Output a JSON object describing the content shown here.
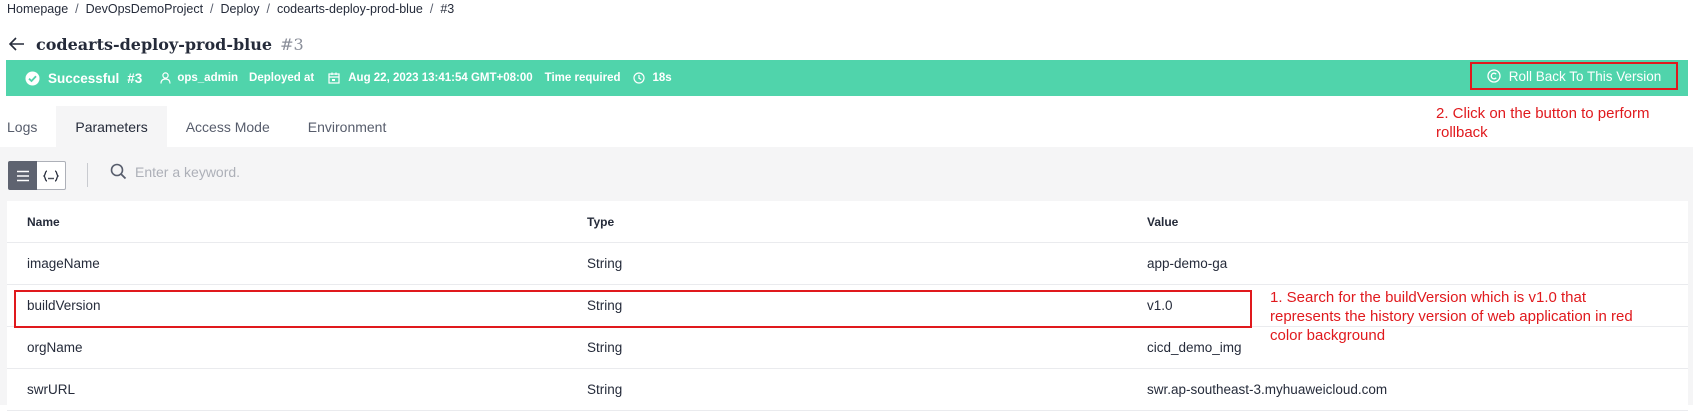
{
  "breadcrumb": [
    "Homepage",
    "DevOpsDemoProject",
    "Deploy",
    "codearts-deploy-prod-blue",
    "#3"
  ],
  "breadcrumb_separator": "/",
  "title": "codearts-deploy-prod-blue",
  "title_run": "#3",
  "status_bar": {
    "status": "Successful",
    "run": "#3",
    "user": "ops_admin",
    "deployed_label": "Deployed at",
    "deployed_time": "Aug 22, 2023 13:41:54 GMT+08:00",
    "time_required_label": "Time required",
    "time_required": "18s",
    "rollback_label": "Roll Back To This Version",
    "color": "#50d4ab"
  },
  "tabs": [
    {
      "label": "Logs"
    },
    {
      "label": "Parameters",
      "active": true
    },
    {
      "label": "Access Mode"
    },
    {
      "label": "Environment"
    }
  ],
  "search": {
    "placeholder": "Enter a keyword."
  },
  "table": {
    "columns": [
      "Name",
      "Type",
      "Value"
    ],
    "rows": [
      [
        "imageName",
        "String",
        "app-demo-ga"
      ],
      [
        "buildVersion",
        "String",
        "v1.0"
      ],
      [
        "orgName",
        "String",
        "cicd_demo_img"
      ],
      [
        "swrURL",
        "String",
        "swr.ap-southeast-3.myhuaweicloud.com"
      ]
    ]
  },
  "annotations": {
    "step1": "1. Search for the buildVersion which is v1.0 that represents the history version of web application in red color background",
    "step2": "2. Click on the button to perform rollback",
    "highlight_color": "#e0191d"
  },
  "icons": {
    "back": "arrow-left-icon",
    "success": "check-circle-icon",
    "user": "user-icon",
    "calendar": "calendar-icon",
    "clock": "clock-icon",
    "rollback": "rollback-icon",
    "list_view": "list-view-icon",
    "code_view": "code-view-icon",
    "search": "search-icon"
  }
}
